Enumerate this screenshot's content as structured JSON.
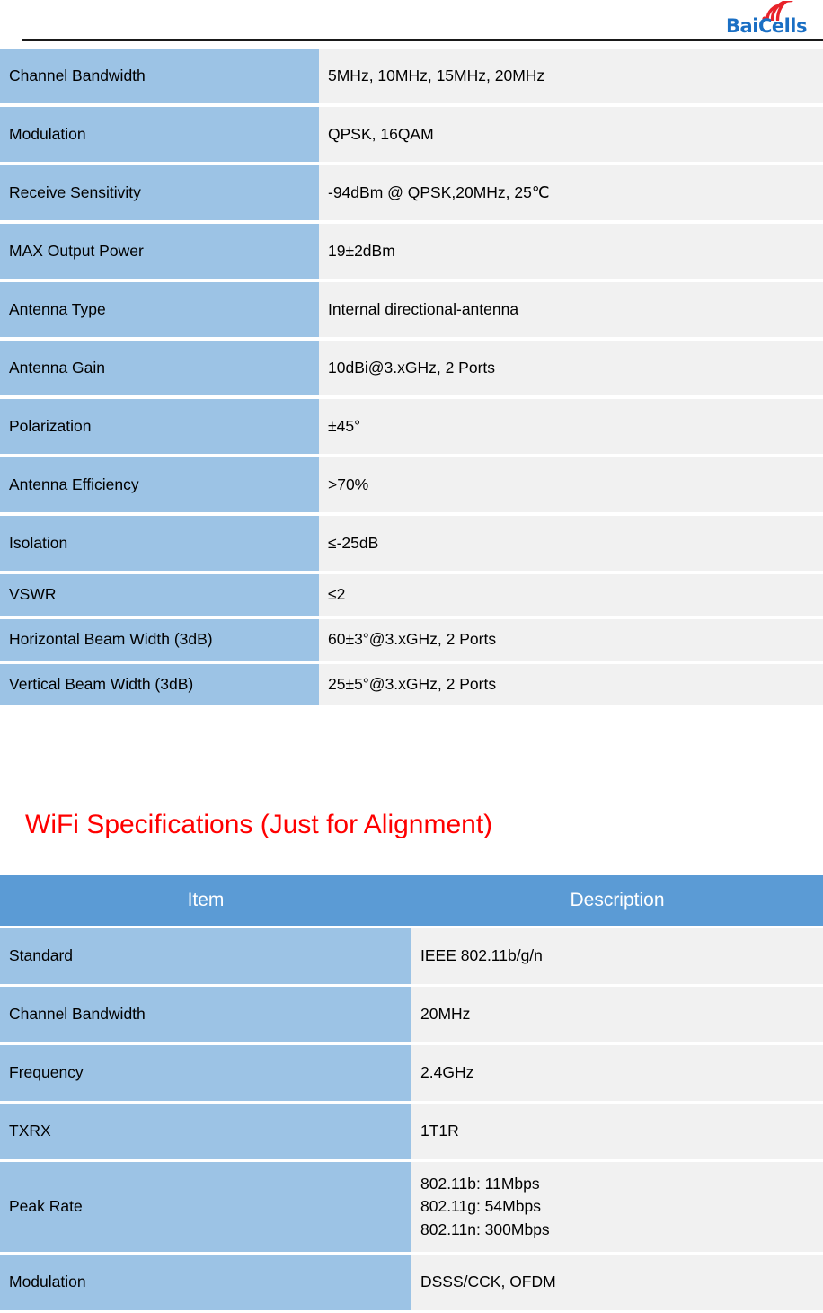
{
  "brand": {
    "name": "BaiCells",
    "name_part1": "Bai",
    "name_part2": "Cells",
    "wifi_icon": "wifi-arc-icon",
    "logo_blue": "#1a6fc4",
    "logo_red": "#e8232a"
  },
  "colors": {
    "label_cell": "#9cc3e5",
    "value_cell": "#f1f1f1",
    "header_blue": "#5b9bd5",
    "title_red": "#ff0000"
  },
  "lte_table": {
    "rows": [
      {
        "label": "Channel Bandwidth",
        "value": "5MHz, 10MHz, 15MHz, 20MHz",
        "size": "tall"
      },
      {
        "label": "Modulation",
        "value": "QPSK, 16QAM",
        "size": "tall"
      },
      {
        "label": "Receive Sensitivity",
        "value": "-94dBm @ QPSK,20MHz, 25℃",
        "size": "tall"
      },
      {
        "label": "MAX Output Power",
        "value": "19±2dBm",
        "size": "tall"
      },
      {
        "label": "Antenna Type",
        "value": "Internal directional-antenna",
        "size": "tall"
      },
      {
        "label": "Antenna Gain",
        "value": "10dBi@3.xGHz, 2 Ports",
        "size": "tall"
      },
      {
        "label": "Polarization",
        "value": "±45°",
        "size": "tall"
      },
      {
        "label": "Antenna Efficiency",
        "value": ">70%",
        "size": "tall"
      },
      {
        "label": "Isolation",
        "value": "≤-25dB",
        "size": "tall"
      },
      {
        "label": "VSWR",
        "value": "≤2",
        "size": "short"
      },
      {
        "label": "Horizontal Beam Width (3dB)",
        "value": "60±3°@3.xGHz, 2 Ports",
        "size": "short"
      },
      {
        "label": "Vertical Beam Width (3dB)",
        "value": "25±5°@3.xGHz, 2 Ports",
        "size": "short"
      }
    ]
  },
  "wifi_section": {
    "title": "WiFi Specifications (Just for Alignment)",
    "headers": {
      "item": "Item",
      "description": "Description"
    },
    "rows": [
      {
        "label": "Standard",
        "value": "IEEE 802.11b/g/n"
      },
      {
        "label": "Channel Bandwidth",
        "value": "20MHz"
      },
      {
        "label": "Frequency",
        "value": "2.4GHz"
      },
      {
        "label": "TXRX",
        "value": "1T1R"
      },
      {
        "label": "Peak Rate",
        "lines": [
          "802.11b: 11Mbps",
          "802.11g: 54Mbps",
          "802.11n: 300Mbps"
        ]
      },
      {
        "label": "Modulation",
        "value": "DSSS/CCK, OFDM"
      }
    ]
  }
}
